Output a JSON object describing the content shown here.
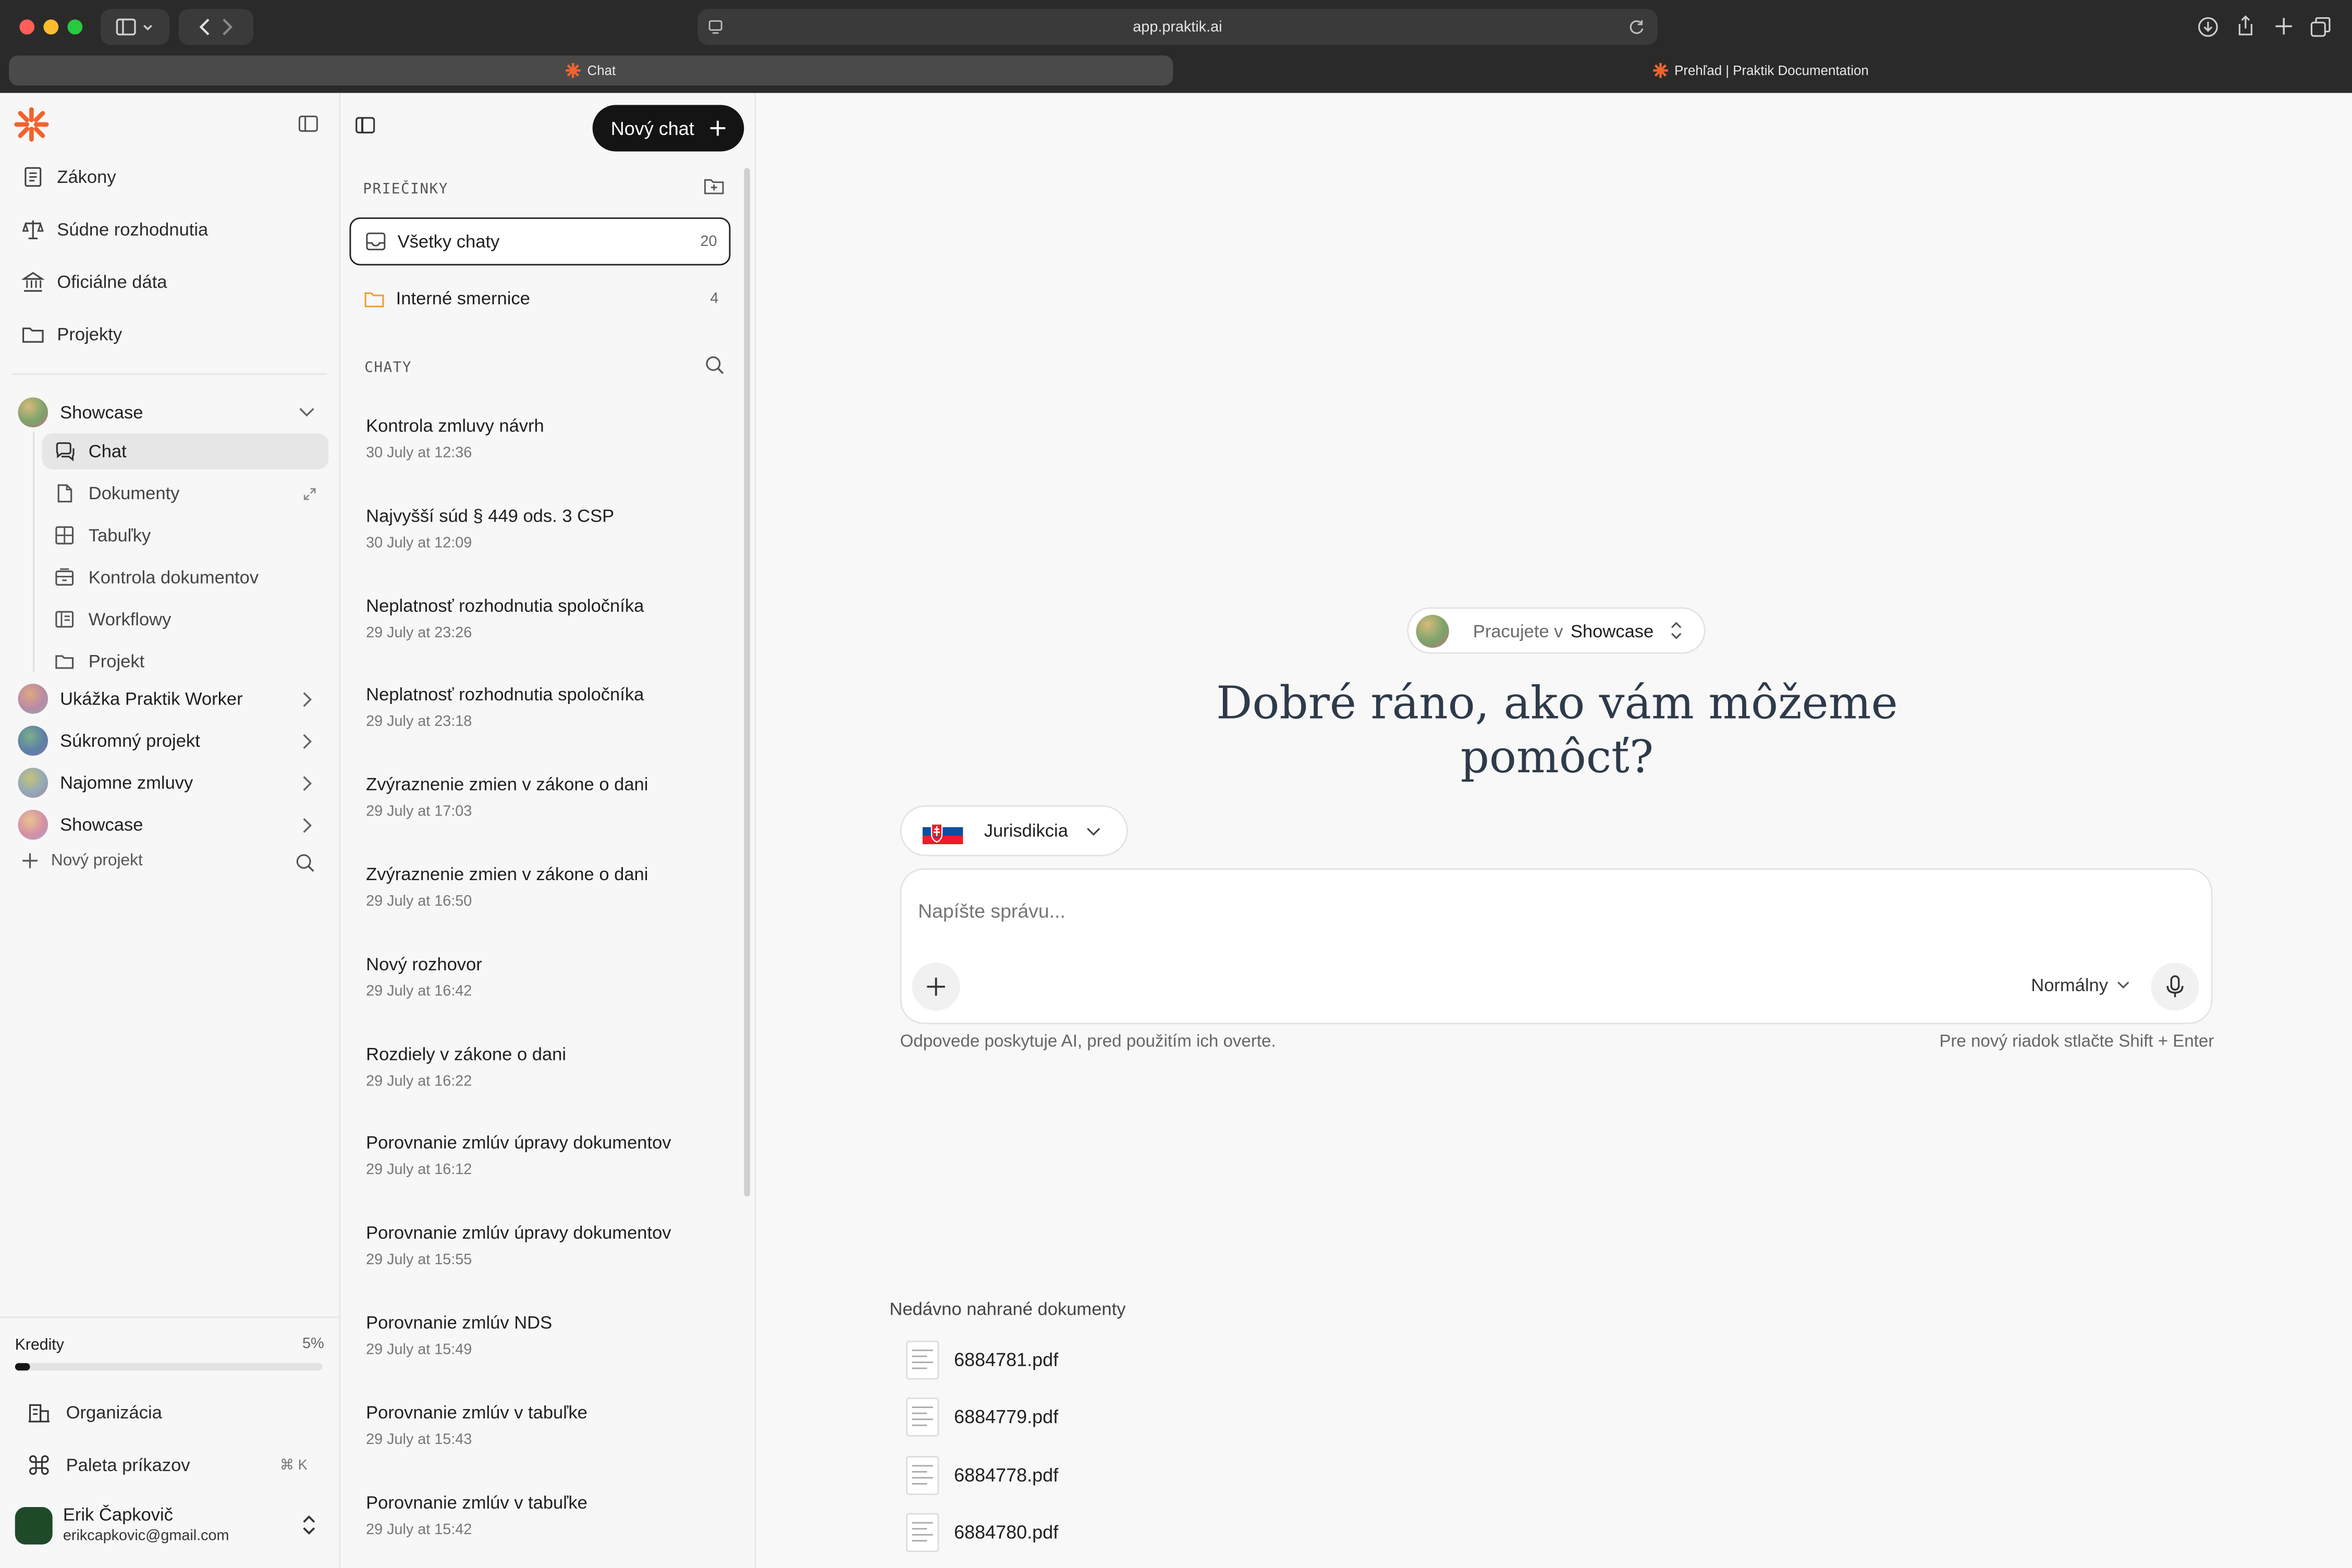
{
  "browser": {
    "url": "app.praktik.ai",
    "tabs": [
      {
        "label": "Chat",
        "active": true
      },
      {
        "label": "Prehľad | Praktik Documentation",
        "active": false
      }
    ]
  },
  "sidebar": {
    "nav": [
      {
        "label": "Zákony",
        "icon": "law-book-icon"
      },
      {
        "label": "Súdne rozhodnutia",
        "icon": "scales-icon"
      },
      {
        "label": "Oficiálne dáta",
        "icon": "bank-icon"
      },
      {
        "label": "Projekty",
        "icon": "folder-icon"
      }
    ],
    "active_project": {
      "label": "Showcase",
      "items": [
        {
          "label": "Chat",
          "icon": "chat-icon",
          "active": true
        },
        {
          "label": "Dokumenty",
          "icon": "document-icon"
        },
        {
          "label": "Tabuľky",
          "icon": "table-icon"
        },
        {
          "label": "Kontrola dokumentov",
          "icon": "inbox-icon"
        },
        {
          "label": "Workflowy",
          "icon": "book-icon"
        },
        {
          "label": "Projekt",
          "icon": "folder-icon"
        }
      ]
    },
    "projects": [
      {
        "label": "Ukážka Praktik Worker"
      },
      {
        "label": "Súkromný projekt"
      },
      {
        "label": "Najomne zmluvy"
      },
      {
        "label": "Showcase"
      }
    ],
    "new_project_label": "Nový projekt",
    "credits": {
      "label": "Kredity",
      "percent_text": "5%",
      "percent": 5
    },
    "bottom": [
      {
        "label": "Organizácia",
        "icon": "building-icon"
      },
      {
        "label": "Paleta príkazov",
        "icon": "command-icon",
        "shortcut": "⌘ K"
      }
    ],
    "user": {
      "name": "Erik Čapkovič",
      "email": "erikcapkovic@gmail.com"
    }
  },
  "chatlist": {
    "new_chat_label": "Nový chat",
    "folders_label": "PRIEČINKY",
    "folders": [
      {
        "label": "Všetky chaty",
        "count": "20"
      },
      {
        "label": "Interné smernice",
        "count": "4"
      }
    ],
    "chats_label": "CHATY",
    "chats": [
      {
        "title": "Kontrola zmluvy návrh",
        "time": "30 July at 12:36"
      },
      {
        "title": "Najvyšší súd § 449 ods. 3 CSP",
        "time": "30 July at 12:09"
      },
      {
        "title": "Neplatnosť rozhodnutia spoločníka",
        "time": "29 July at 23:26"
      },
      {
        "title": "Neplatnosť rozhodnutia spoločníka",
        "time": "29 July at 23:18"
      },
      {
        "title": "Zvýraznenie zmien v zákone o dani",
        "time": "29 July at 17:03"
      },
      {
        "title": "Zvýraznenie zmien v zákone o dani",
        "time": "29 July at 16:50"
      },
      {
        "title": "Nový rozhovor",
        "time": "29 July at 16:42"
      },
      {
        "title": "Rozdiely v zákone o dani",
        "time": "29 July at 16:22"
      },
      {
        "title": "Porovnanie zmlúv úpravy dokumentov",
        "time": "29 July at 16:12"
      },
      {
        "title": "Porovnanie zmlúv úpravy dokumentov",
        "time": "29 July at 15:55"
      },
      {
        "title": "Porovnanie zmlúv NDS",
        "time": "29 July at 15:49"
      },
      {
        "title": "Porovnanie zmlúv v tabuľke",
        "time": "29 July at 15:43"
      },
      {
        "title": "Porovnanie zmlúv v tabuľke",
        "time": "29 July at 15:42"
      }
    ]
  },
  "main": {
    "workspace_prefix": "Pracujete v",
    "workspace_name": "Showcase",
    "greeting_line1": "Dobré ráno, ako vám môžeme",
    "greeting_line2": "pomôcť?",
    "jurisdiction_label": "Jurisdikcia",
    "input_placeholder": "Napíšte správu...",
    "mode_label": "Normálny",
    "disclaimer": "Odpovede poskytuje AI, pred použitím ich overte.",
    "hint": "Pre nový riadok stlačte Shift + Enter",
    "recent_label": "Nedávno nahrané dokumenty",
    "recent_docs": [
      "6884781.pdf",
      "6884779.pdf",
      "6884778.pdf",
      "6884780.pdf"
    ]
  },
  "colors": {
    "brand": "#f0632e",
    "accent_dark": "#141414",
    "greeting": "#2e3a4a"
  }
}
